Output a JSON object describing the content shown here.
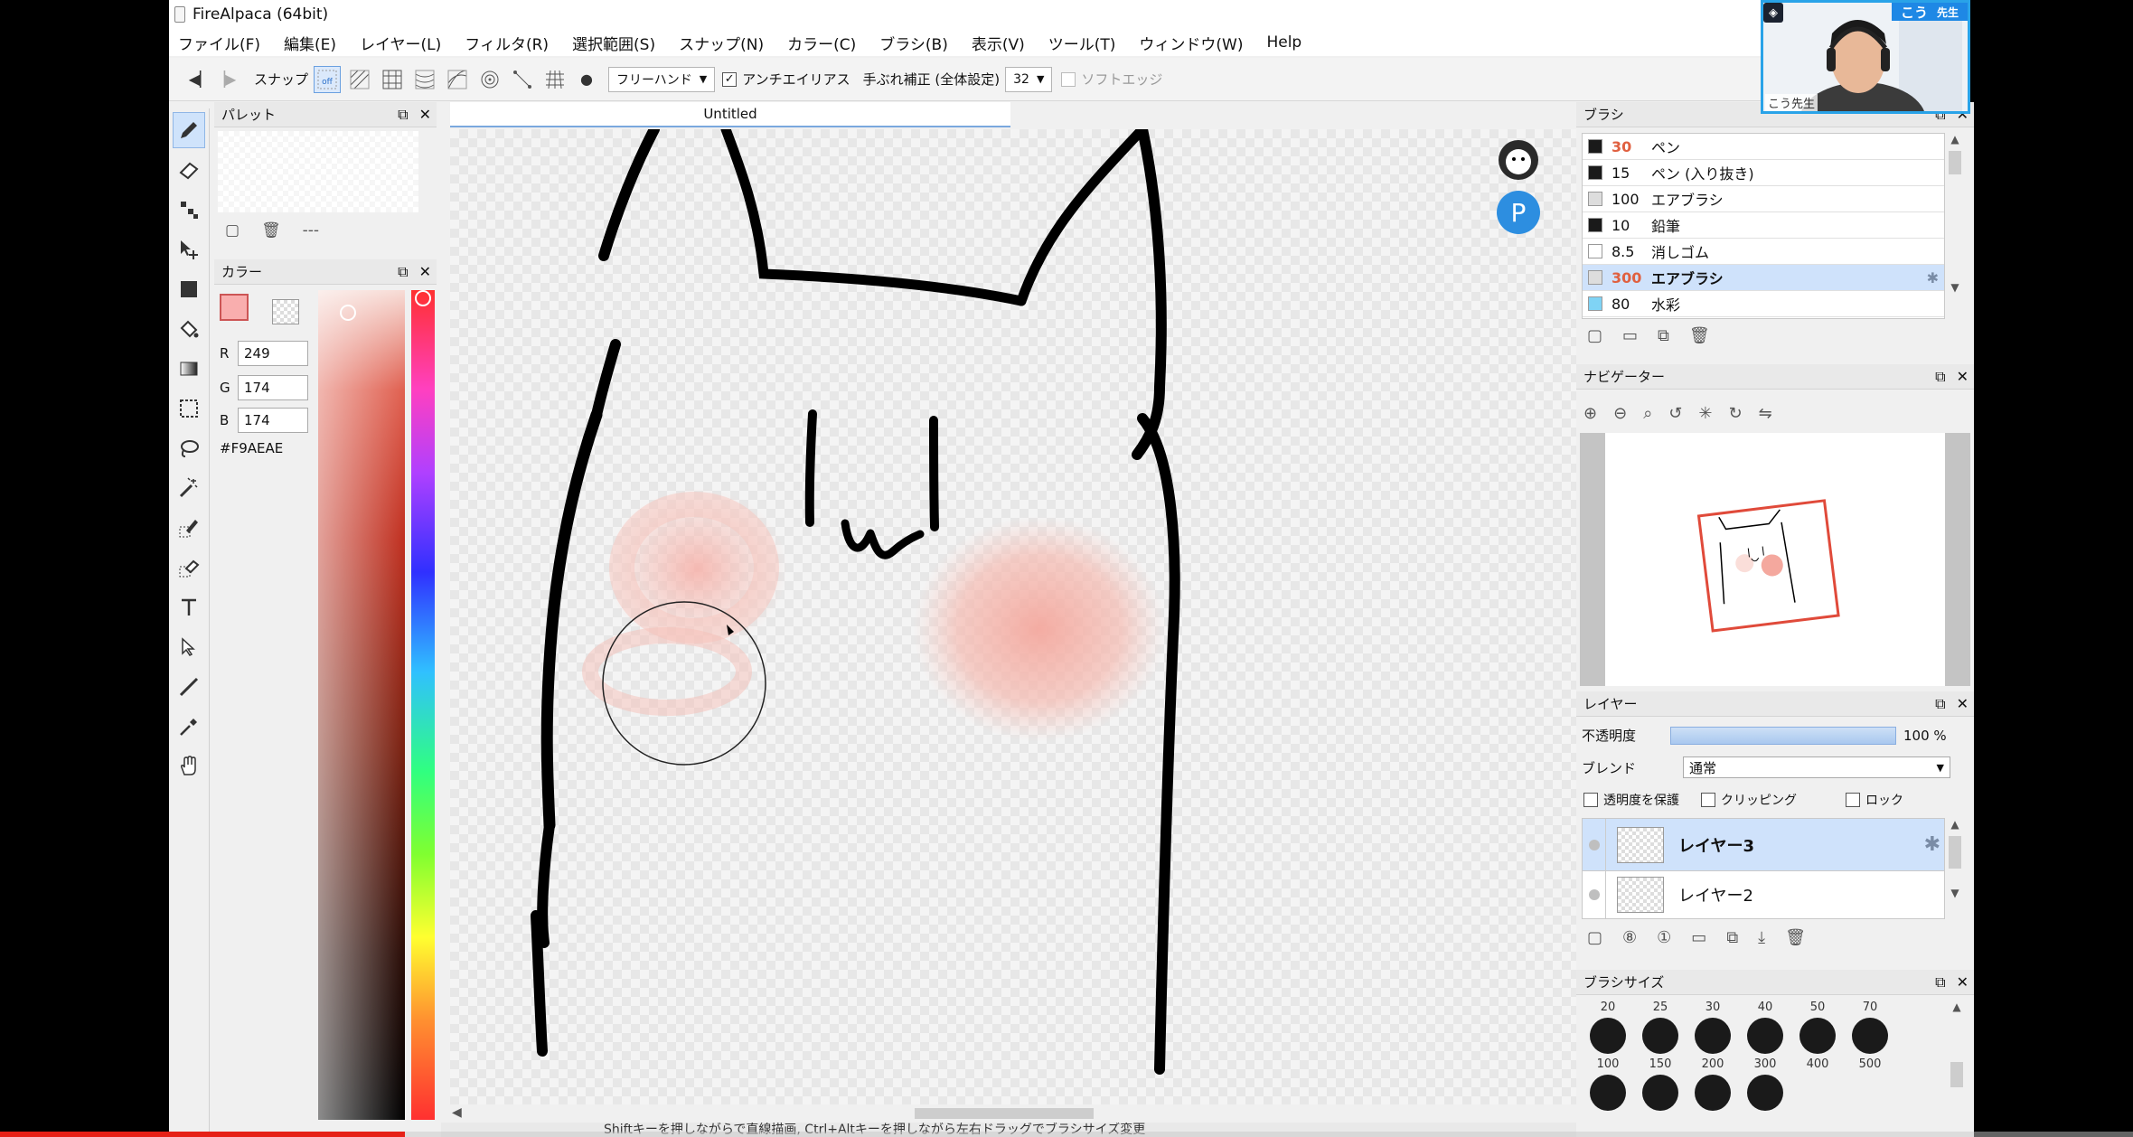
{
  "window": {
    "title": "FireAlpaca (64bit)"
  },
  "menu": [
    "ファイル(F)",
    "編集(E)",
    "レイヤー(L)",
    "フィルタ(R)",
    "選択範囲(S)",
    "スナップ(N)",
    "カラー(C)",
    "ブラシ(B)",
    "表示(V)",
    "ツール(T)",
    "ウィンドウ(W)",
    "Help"
  ],
  "toolbar": {
    "snap_label": "スナップ",
    "snap_off_label": "off",
    "stroke_mode": "フリーハンド",
    "antialias_label": "アンチエイリアス",
    "antialias_checked": true,
    "stabilizer_label": "手ぶれ補正 (全体設定)",
    "stabilizer_value": "32",
    "soft_edge_label": "ソフトエッジ",
    "soft_edge_checked": false
  },
  "palette": {
    "title": "パレット",
    "empty_label": "---"
  },
  "color": {
    "title": "カラー",
    "r_label": "R",
    "g_label": "G",
    "b_label": "B",
    "r": "249",
    "g": "174",
    "b": "174",
    "hex": "#F9AEAE",
    "current": "#F9AEAE"
  },
  "document": {
    "tab": "Untitled"
  },
  "status": {
    "hint": "Shiftキーを押しながらで直線描画, Ctrl+Altキーを押しながら左右ドラッグでブラシサイズ変更"
  },
  "brush": {
    "title": "ブラシ",
    "items": [
      {
        "size": "30",
        "name": "ペン",
        "color": "#1a1a1a"
      },
      {
        "size": "15",
        "name": "ペン (入り抜き)",
        "color": "#1a1a1a"
      },
      {
        "size": "100",
        "name": "エアブラシ",
        "color": "#dddddd"
      },
      {
        "size": "10",
        "name": "鉛筆",
        "color": "#1a1a1a"
      },
      {
        "size": "8.5",
        "name": "消しゴム",
        "color": "#ffffff"
      },
      {
        "size": "300",
        "name": "エアブラシ",
        "color": "#dddddd"
      },
      {
        "size": "80",
        "name": "水彩",
        "color": "#7fd3f5"
      }
    ],
    "selected_index": 5
  },
  "navigator": {
    "title": "ナビゲーター"
  },
  "layer": {
    "title": "レイヤー",
    "opacity_label": "不透明度",
    "opacity_value": "100 %",
    "opacity": 1.0,
    "blend_label": "ブレンド",
    "blend_value": "通常",
    "protect_alpha_label": "透明度を保護",
    "clipping_label": "クリッピング",
    "lock_label": "ロック",
    "items": [
      {
        "name": "レイヤー3",
        "selected": true
      },
      {
        "name": "レイヤー2",
        "selected": false
      }
    ]
  },
  "brush_size": {
    "title": "ブラシサイズ",
    "row1": [
      "20",
      "25",
      "30",
      "40",
      "50",
      "70"
    ],
    "row2": [
      "100",
      "150",
      "200",
      "300",
      "400",
      "500"
    ]
  },
  "webcam": {
    "badge_name": "こう",
    "badge_role": "先生",
    "caption": "こう先生"
  },
  "video_progress": 0.19
}
